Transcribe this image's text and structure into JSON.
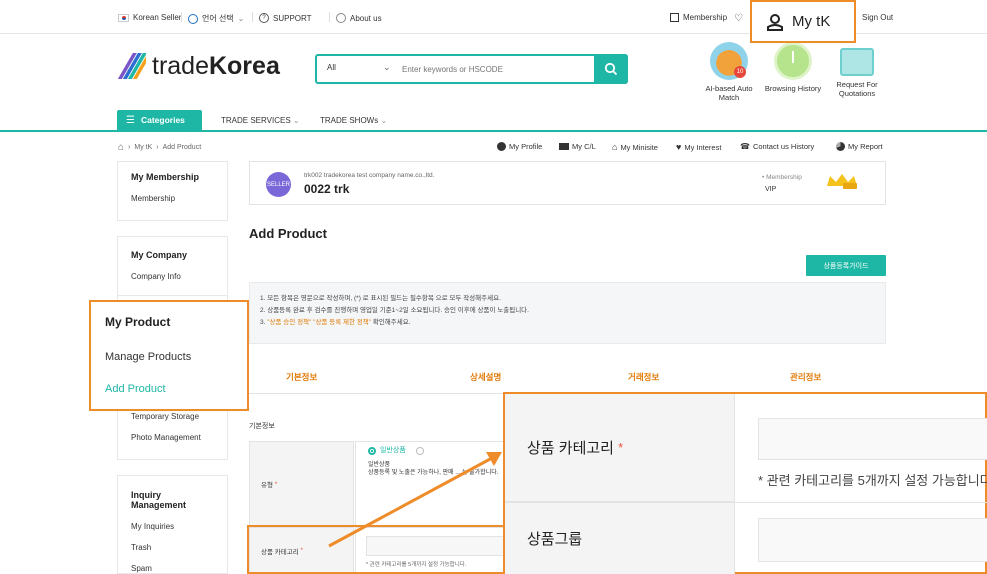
{
  "topbar": {
    "korean_seller": "Korean Seller",
    "language": "언어 선택",
    "support": "SUPPORT",
    "about": "About us",
    "membership": "Membership",
    "signout": "Sign Out"
  },
  "mytk_callout": "My tK",
  "logo": {
    "light": "trade",
    "bold": "Korea"
  },
  "search": {
    "category": "All",
    "placeholder": "Enter keywords or HSCODE"
  },
  "quick_links": [
    {
      "label": "AI-based Auto Match",
      "badge": "10"
    },
    {
      "label": "Browsing History"
    },
    {
      "label": "Request For Quotations"
    }
  ],
  "nav": {
    "categories": "Categories",
    "trade_services": "TRADE SERVICES",
    "trade_shows": "TRADE SHOWs"
  },
  "breadcrumb": {
    "home": "⌂",
    "mytk": "My tK",
    "current": "Add Product"
  },
  "my_links": [
    "My Profile",
    "My C/L",
    "My Minisite",
    "My Interest",
    "Contact us History",
    "My Report"
  ],
  "sidebar": {
    "membership_title": "My Membership",
    "membership_link": "Membership",
    "company_title": "My Company",
    "company_link": "Company Info",
    "product_links": [
      "Temporary Storage",
      "Photo Management"
    ],
    "inquiry_title": "Inquiry Management",
    "inquiry_links": [
      "My Inquiries",
      "Trash",
      "Spam"
    ]
  },
  "callout_product": {
    "title": "My Product",
    "manage": "Manage Products",
    "add": "Add Product"
  },
  "member": {
    "badge": "SELLER",
    "company": "trk002 tradekorea test company name.co.,ltd.",
    "name": "0022 trk",
    "membership_label": "• Membership",
    "membership_value": "VIP"
  },
  "page_title": "Add Product",
  "guide_button": "상품등록가이드",
  "notice": {
    "line1": "1. 모든 항목은 영문으로 작성하며, (*) 로 표시된 필드는 필수항목 으로 모두 작성해주세요.",
    "line2": "2. 상품등록 완료 후 검수를 진행하며 영업일 기준1~2일 소요됩니다. 승인 이후에 상품이 노출됩니다.",
    "line3_prefix": "3. ",
    "line3_hl": "\"상품 승인 정책\" \"상품 등록 제한 정책\"",
    "line3_suffix": " 확인해주세요."
  },
  "tabs": [
    "기본정보",
    "상세설명",
    "거래정보",
    "관리정보"
  ],
  "form": {
    "section": "기본정보",
    "type_label": "유형",
    "type_option": "일반상품",
    "type_desc_title": "일반상품",
    "type_desc": "상품등록 및 노출은 가능하나, 판매 ... 는 불가합니다.",
    "category_label": "상품 카테고리",
    "category_help": "* 관련 카테고리를 5개까지 설정 가능합니다."
  },
  "zoom": {
    "category_label": "상품 카테고리",
    "category_help": "* 관련 카테고리를 5개까지 설정 가능합니다",
    "group_label": "상품그룹"
  }
}
